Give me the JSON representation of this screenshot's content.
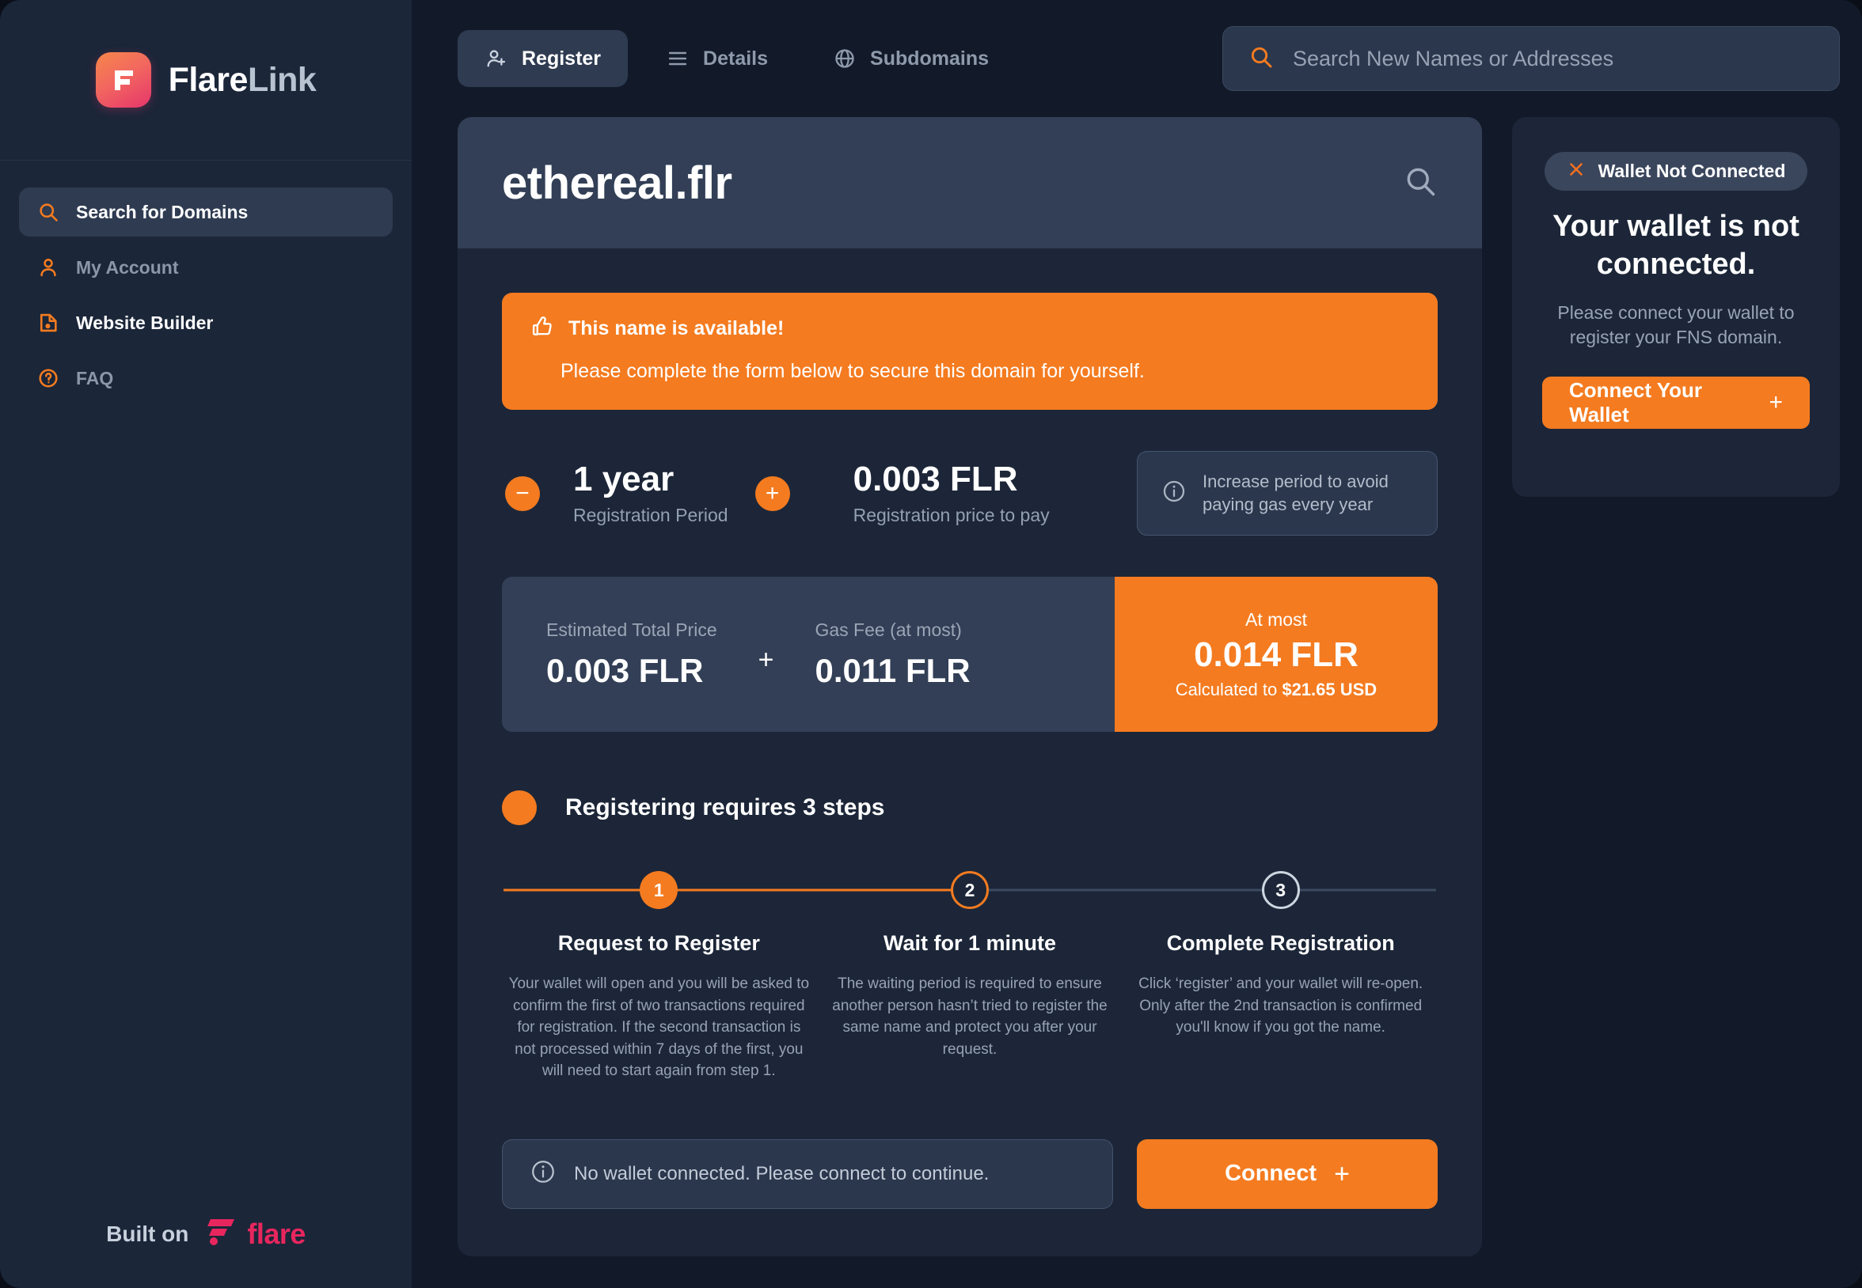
{
  "brand": {
    "name_primary": "Flare",
    "name_secondary": "Link",
    "logo_icon": "flarelink-logo-icon"
  },
  "sidebar": {
    "items": [
      {
        "label": "Search for Domains",
        "icon": "search-icon",
        "active": true
      },
      {
        "label": "My Account",
        "icon": "user-icon",
        "active": false
      },
      {
        "label": "Website Builder",
        "icon": "website-builder-icon",
        "active": false
      },
      {
        "label": "FAQ",
        "icon": "question-circle-icon",
        "active": false
      }
    ],
    "footer": {
      "built_on_label": "Built on",
      "partner_name": "flare",
      "partner_icon": "flare-logo-icon"
    }
  },
  "topbar": {
    "tabs": [
      {
        "label": "Register",
        "icon": "user-plus-icon",
        "active": true
      },
      {
        "label": "Details",
        "icon": "list-lines-icon",
        "active": false
      },
      {
        "label": "Subdomains",
        "icon": "globe-icon",
        "active": false
      }
    ],
    "search": {
      "placeholder": "Search New Names or Addresses",
      "value": "",
      "icon": "search-icon"
    }
  },
  "card": {
    "domain_name": "ethereal.flr",
    "search_icon": "search-icon",
    "banner": {
      "icon": "thumbs-up-icon",
      "title": "This name is available!",
      "subtitle": "Please complete the form below to secure this domain for yourself."
    },
    "period": {
      "decrement_label": "−",
      "increment_label": "+",
      "value": "1 year",
      "label": "Registration Period"
    },
    "price": {
      "value": "0.003 FLR",
      "label": "Registration price to pay"
    },
    "tip": {
      "icon": "info-circle-icon",
      "text": "Increase period to avoid paying gas every year"
    },
    "totals": {
      "estimated": {
        "label": "Estimated Total Price",
        "value": "0.003 FLR"
      },
      "operator": "+",
      "gas": {
        "label": "Gas Fee (at most)",
        "value": "0.011 FLR"
      },
      "at_most": {
        "label": "At most",
        "value": "0.014 FLR",
        "calc_prefix": "Calculated to ",
        "calc_amount": "$21.65 USD"
      }
    },
    "steps_header": "Registering requires 3 steps",
    "steps": [
      {
        "number": "1",
        "state": "filled",
        "label": "Request to Register",
        "description": "Your wallet will open and you will be asked to confirm the first of two transactions required for registration. If the second transaction is not processed within 7 days of the first, you will need to start again from step 1."
      },
      {
        "number": "2",
        "state": "ring-orange",
        "label": "Wait for 1 minute",
        "description": "The waiting period is required to ensure another person hasn’t tried to register the same name and protect you after your request."
      },
      {
        "number": "3",
        "state": "ring-grey",
        "label": "Complete Registration",
        "description": "Click ‘register’ and your wallet will re-open. Only after the 2nd transaction is confirmed you'll know if you got the name."
      }
    ],
    "notice": {
      "icon": "info-circle-icon",
      "text": "No wallet connected. Please connect to continue."
    },
    "connect_button": {
      "label": "Connect",
      "plus": "+"
    }
  },
  "wallet_panel": {
    "badge": {
      "icon": "x-close-icon",
      "label": "Wallet Not Connected"
    },
    "title": "Your wallet is not connected.",
    "subtitle": "Please connect your wallet to register your FNS domain.",
    "button": {
      "label": "Connect Your Wallet",
      "plus": "+"
    }
  },
  "colors": {
    "accent_orange": "#f47b20",
    "brand_pink": "#e8265e",
    "page_bg": "#121a29",
    "sidebar_bg": "#1b2639",
    "card_bg": "#1c2638",
    "card_head_bg": "#323f56",
    "panel_alt_bg": "#2b374d"
  }
}
